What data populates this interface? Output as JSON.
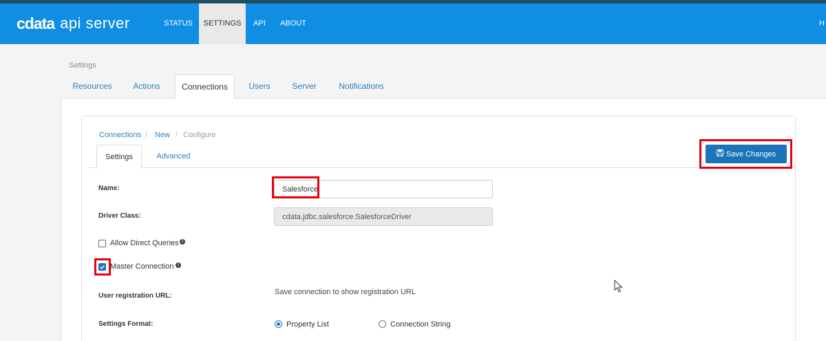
{
  "app": {
    "logo_brand": "cdata",
    "logo_product": "api server"
  },
  "nav": {
    "items": [
      {
        "label": "STATUS"
      },
      {
        "label": "SETTINGS"
      },
      {
        "label": "API"
      },
      {
        "label": "ABOUT"
      }
    ],
    "cut_off": "H"
  },
  "page": {
    "label": "Settings"
  },
  "tabs": [
    "Resources",
    "Actions",
    "Connections",
    "Users",
    "Server",
    "Notifications"
  ],
  "breadcrumb": {
    "part1": "Connections",
    "part2": "New",
    "part3": "Configure",
    "sep": "/"
  },
  "subtabs": [
    "Settings",
    "Advanced"
  ],
  "toolbar": {
    "save_label": "Save Changes"
  },
  "form": {
    "name_label": "Name:",
    "name_value": "Salesforce",
    "driver_label": "Driver Class:",
    "driver_value": "cdata.jdbc.salesforce.SalesforceDriver",
    "allow_direct_label": "Allow Direct Queries",
    "allow_direct_checked": false,
    "master_label": "Master Connection",
    "master_checked": true,
    "reg_url_label": "User registration URL:",
    "reg_url_text": "Save connection to show registration URL",
    "format_label": "Settings Format:",
    "format_option1": "Property List",
    "format_option2": "Connection String",
    "format_selected": "Property List",
    "info_glyph": "i"
  },
  "colors": {
    "nav_blue": "#0f8ee3",
    "accent": "#1a74b8",
    "highlight": "#e8000b"
  }
}
